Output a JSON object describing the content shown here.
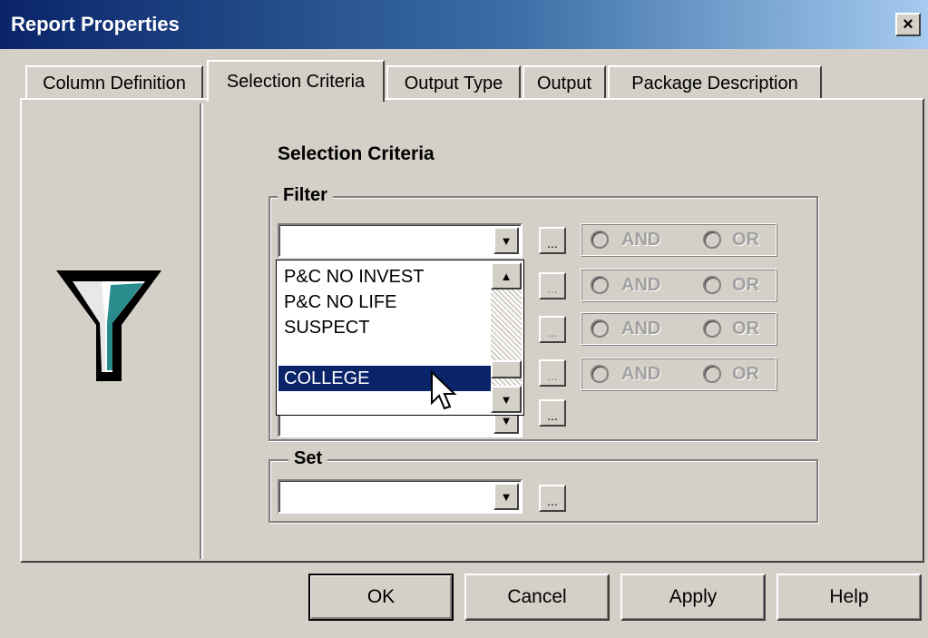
{
  "window": {
    "title": "Report Properties",
    "close_label": "×"
  },
  "tabs": [
    {
      "label": "Column Definition",
      "active": false
    },
    {
      "label": "Selection Criteria",
      "active": true
    },
    {
      "label": "Output Type",
      "active": false
    },
    {
      "label": "Output",
      "active": false
    },
    {
      "label": "Package Description",
      "active": false
    }
  ],
  "main": {
    "heading": "Selection Criteria",
    "filter": {
      "label": "Filter",
      "combo_value": "",
      "radio_rows": [
        {
          "and_label": "AND",
          "or_label": "OR"
        },
        {
          "and_label": "AND",
          "or_label": "OR"
        },
        {
          "and_label": "AND",
          "or_label": "OR"
        },
        {
          "and_label": "AND",
          "or_label": "OR"
        }
      ],
      "dropdown_items": [
        "P&C NO INVEST",
        "P&C NO LIFE",
        "SUSPECT",
        "",
        "COLLEGE"
      ],
      "selected_item": "COLLEGE",
      "ellipsis_label": "..."
    },
    "set": {
      "label": "Set",
      "combo_value": "",
      "ellipsis_label": "..."
    }
  },
  "buttons": {
    "ok": "OK",
    "cancel": "Cancel",
    "apply": "Apply",
    "help": "Help"
  },
  "icons": {
    "funnel": "funnel-icon",
    "arrow": "chevron-down-icon",
    "scroll_up": "scroll-up-icon",
    "cursor": "mouse-pointer-icon"
  },
  "colors": {
    "title_bar": "#0a246a",
    "selection": "#0a246a",
    "face": "#d4d0c8",
    "funnel_accent": "#2a8c8c"
  }
}
